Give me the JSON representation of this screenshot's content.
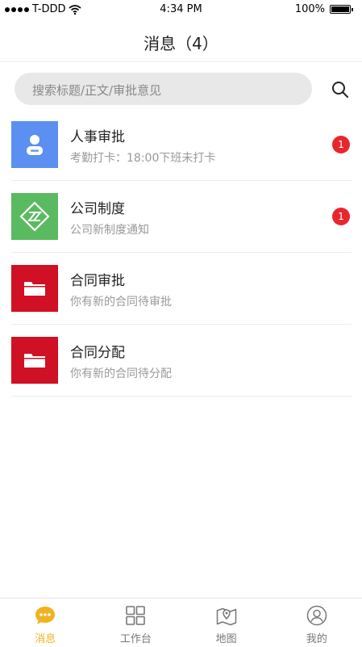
{
  "status_bar": {
    "carrier": "T-DDD",
    "time": "4:34 PM",
    "battery": "100%"
  },
  "header": {
    "title": "消息（4）"
  },
  "search": {
    "placeholder": "搜索标题/正文/审批意见"
  },
  "messages": [
    {
      "title": "人事审批",
      "subtitle": "考勤打卡：18:00下班未打卡",
      "badge": "1",
      "icon": "person-icon",
      "color": "#5b8ff1"
    },
    {
      "title": "公司制度",
      "subtitle": "公司新制度通知",
      "badge": "1",
      "icon": "logo-icon",
      "color": "#5aba5f"
    },
    {
      "title": "合同审批",
      "subtitle": "你有新的合同待审批",
      "badge": "",
      "icon": "folder-icon",
      "color": "#d01024"
    },
    {
      "title": "合同分配",
      "subtitle": "你有新的合同待分配",
      "badge": "",
      "icon": "folder-icon",
      "color": "#d01024"
    }
  ],
  "tabbar": {
    "items": [
      {
        "label": "消息",
        "icon": "chat-icon",
        "active": true
      },
      {
        "label": "工作台",
        "icon": "grid-icon",
        "active": false
      },
      {
        "label": "地图",
        "icon": "map-icon",
        "active": false
      },
      {
        "label": "我的",
        "icon": "profile-icon",
        "active": false
      }
    ],
    "active_color": "#f0b21e"
  }
}
